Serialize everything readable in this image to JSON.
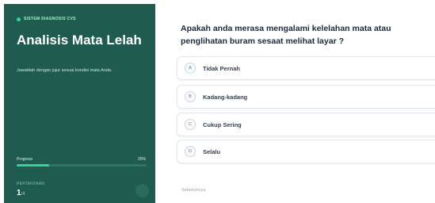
{
  "sidebar": {
    "brand": "SISTEM DIAGNOSIS CVS",
    "title": "Analisis Mata Lelah",
    "subtitle": "Jawablah dengan jujur sesuai kondisi mata Anda.",
    "progress_label": "Progress",
    "progress_percent_text": "25%",
    "progress_value": 0.25,
    "question_label": "PERTANYAAN",
    "question_current": "1",
    "question_total": "/4"
  },
  "main": {
    "question": "Apakah anda merasa mengalami kelelahan mata atau penglihatan buram sesaat melihat layar ?",
    "options": [
      {
        "letter": "A",
        "label": "Tidak Pernah"
      },
      {
        "letter": "B",
        "label": "Kadang-kadang"
      },
      {
        "letter": "C",
        "label": "Cukup Sering"
      },
      {
        "letter": "D",
        "label": "Selalu"
      }
    ],
    "prev_label": "Sebelumnya"
  },
  "colors": {
    "sidebar_bg": "#1f5b4f",
    "accent": "#34d399"
  }
}
